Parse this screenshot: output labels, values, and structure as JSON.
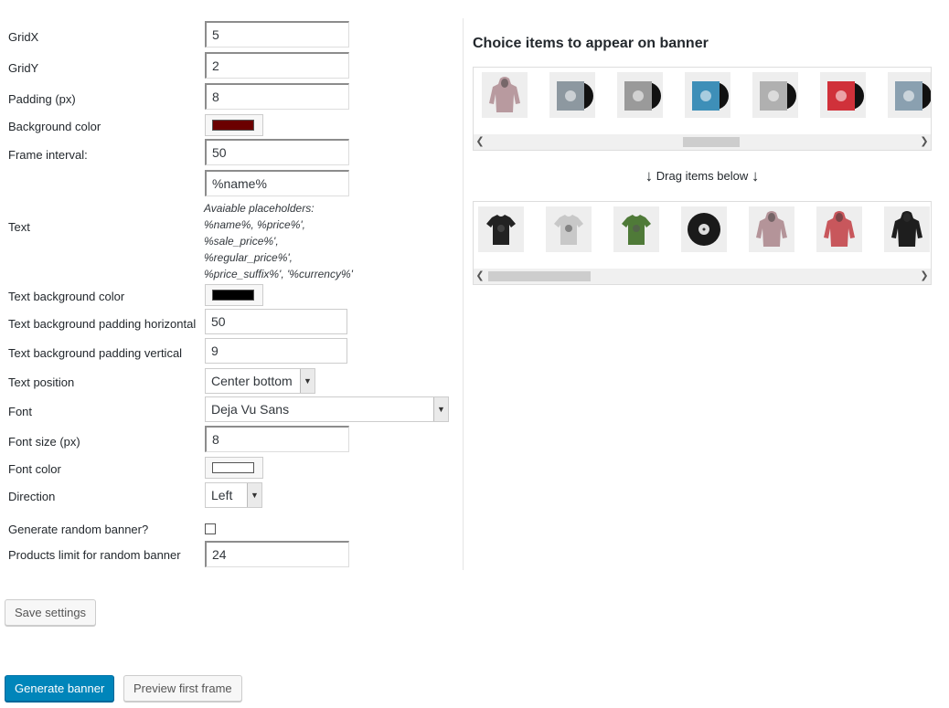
{
  "settings": {
    "gridx": {
      "label": "GridX",
      "value": "5"
    },
    "gridy": {
      "label": "GridY",
      "value": "2"
    },
    "padding": {
      "label": "Padding (px)",
      "value": "8"
    },
    "background_color": {
      "label": "Background color",
      "color": "#6b0000"
    },
    "frame_interval": {
      "label": "Frame interval:",
      "value": "50"
    },
    "text": {
      "label": "Text",
      "value": "%name%",
      "hint_lines": [
        "Avaiable placeholders:",
        "%name%, %price%',",
        "%sale_price%',",
        "%regular_price%',",
        "%price_suffix%', '%currency%'"
      ]
    },
    "text_bg_color": {
      "label": "Text background color",
      "color": "#000000"
    },
    "text_bg_pad_h": {
      "label": "Text background padding horizontal",
      "value": "50"
    },
    "text_bg_pad_v": {
      "label": "Text background padding vertical",
      "value": "9"
    },
    "text_position": {
      "label": "Text position",
      "selected": "Center bottom"
    },
    "font": {
      "label": "Font",
      "selected": "Deja Vu Sans"
    },
    "font_size": {
      "label": "Font size (px)",
      "value": "8"
    },
    "font_color": {
      "label": "Font color",
      "color": "#ffffff"
    },
    "direction": {
      "label": "Direction",
      "selected": "Left"
    },
    "random_banner": {
      "label": "Generate random banner?",
      "checked": false
    },
    "products_limit": {
      "label": "Products limit for random banner",
      "value": "24"
    }
  },
  "buttons": {
    "save": "Save settings",
    "generate": "Generate banner",
    "preview": "Preview first frame"
  },
  "panel": {
    "title": "Choice items to appear on banner",
    "drag_hint": "Drag items below",
    "available_items": [
      {
        "icon": "hoodie-pink-icon",
        "color": "#b89a9f"
      },
      {
        "icon": "vinyl-album-icon",
        "color": "#8d98a0"
      },
      {
        "icon": "vinyl-album-icon",
        "color": "#9a9a9a"
      },
      {
        "icon": "vinyl-album-icon",
        "color": "#3e8fb8"
      },
      {
        "icon": "vinyl-album-icon",
        "color": "#b0b0b0"
      },
      {
        "icon": "vinyl-album-icon",
        "color": "#d0313a"
      },
      {
        "icon": "vinyl-album-icon",
        "color": "#8aa0b0"
      }
    ],
    "selected_items": [
      {
        "icon": "tshirt-black-icon",
        "color": "#222222"
      },
      {
        "icon": "tshirt-grey-icon",
        "color": "#c8c8c8"
      },
      {
        "icon": "tshirt-green-icon",
        "color": "#4f7a38"
      },
      {
        "icon": "vinyl-record-icon",
        "color": "#1a1a1a"
      },
      {
        "icon": "hoodie-pink-icon",
        "color": "#b49499"
      },
      {
        "icon": "hoodie-red-icon",
        "color": "#c8575c"
      },
      {
        "icon": "hoodie-black-icon",
        "color": "#1e1e1e"
      }
    ]
  }
}
